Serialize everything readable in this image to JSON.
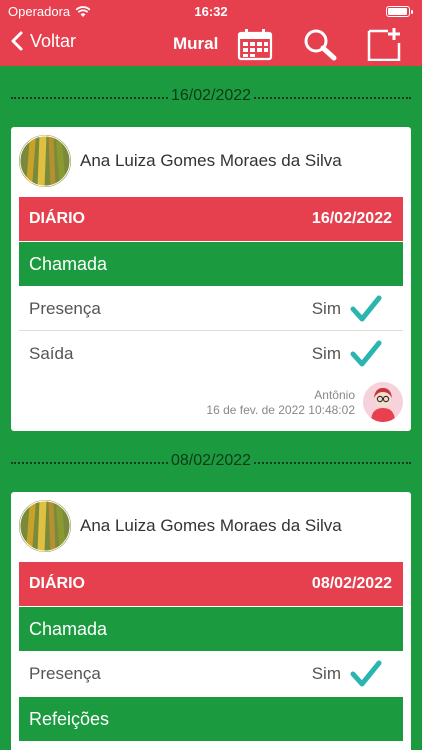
{
  "status": {
    "carrier": "Operadora",
    "time": "16:32"
  },
  "nav": {
    "back_label": "Voltar",
    "title": "Mural",
    "icons": [
      "calendar-icon",
      "search-icon",
      "new-post-icon"
    ]
  },
  "colors": {
    "primary_red": "#e6404f",
    "primary_green": "#1c9a3f",
    "check_teal": "#2bb5b0"
  },
  "posts": [
    {
      "date": "16/02/2022",
      "student": "Ana Luiza Gomes Moraes da Silva",
      "header_label": "DIÁRIO",
      "header_date": "16/02/2022",
      "section": "Chamada",
      "items": [
        {
          "label": "Presença",
          "value": "Sim"
        },
        {
          "label": "Saída",
          "value": "Sim"
        }
      ],
      "author": "Antônio",
      "timestamp": "16 de fev. de 2022 10:48:02"
    },
    {
      "date": "08/02/2022",
      "student": "Ana Luiza Gomes Moraes da Silva",
      "header_label": "DIÁRIO",
      "header_date": "08/02/2022",
      "section": "Chamada",
      "items": [
        {
          "label": "Presença",
          "value": "Sim"
        }
      ],
      "section2": "Refeições"
    }
  ]
}
